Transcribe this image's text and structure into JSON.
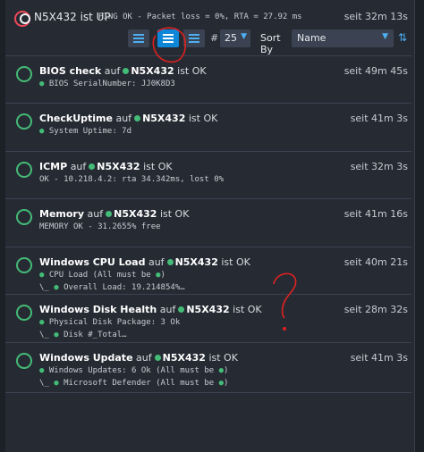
{
  "header": {
    "host_name": "N5X432",
    "host_state": "ist UP",
    "host_output": "PING OK - Packet loss = 0%, RTA = 27.92 ms",
    "host_since": "seit 32m 13s"
  },
  "toolbar": {
    "hash": "#",
    "limit_value": "25",
    "sort_label": "Sort By",
    "sort_value": "Name"
  },
  "services": [
    {
      "name": "BIOS check",
      "on": "auf",
      "host": "N5X432",
      "state": "ist OK",
      "since": "seit 49m 45s",
      "lines": [
        "● BIOS SerialNumber: JJ0K8D3"
      ]
    },
    {
      "name": "CheckUptime",
      "on": "auf",
      "host": "N5X432",
      "state": "ist OK",
      "since": "seit 41m 3s",
      "lines": [
        "● System Uptime: 7d"
      ]
    },
    {
      "name": "ICMP",
      "on": "auf",
      "host": "N5X432",
      "state": "ist OK",
      "since": "seit 32m 3s",
      "lines": [
        "OK - 10.218.4.2: rta 34.342ms, lost 0%"
      ]
    },
    {
      "name": "Memory",
      "on": "auf",
      "host": "N5X432",
      "state": "ist OK",
      "since": "seit 41m 16s",
      "lines": [
        "MEMORY OK - 31.2655% free"
      ]
    },
    {
      "name": "Windows CPU Load",
      "on": "auf",
      "host": "N5X432",
      "state": "ist OK",
      "since": "seit 40m 21s",
      "lines": [
        "● CPU Load (All must be ●)",
        "\\_ ● Overall Load: 19.214854%…"
      ]
    },
    {
      "name": "Windows Disk Health",
      "on": "auf",
      "host": "N5X432",
      "state": "ist OK",
      "since": "seit 28m 32s",
      "lines": [
        "● Physical Disk Package: 3 Ok",
        "\\_ ● Disk #_Total…"
      ]
    },
    {
      "name": "Windows Update",
      "on": "auf",
      "host": "N5X432",
      "state": "ist OK",
      "since": "seit 41m 3s",
      "lines": [
        "● Windows Updates: 6 Ok (All must be ●)",
        "\\_ ● Microsoft Defender (All must be ●)"
      ]
    }
  ],
  "colors": {
    "ok": "#44bb77",
    "down": "#f0475a",
    "accent": "#0f87d8"
  }
}
